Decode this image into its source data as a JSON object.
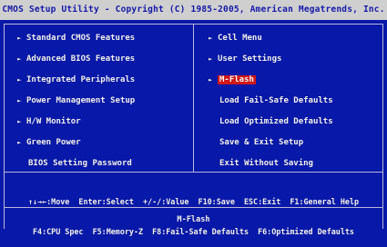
{
  "title": "CMOS Setup Utility - Copyright (C) 1985-2005, American Megatrends, Inc.",
  "left_menu": [
    {
      "label": "Standard CMOS Features",
      "arrow": true
    },
    {
      "label": "Advanced BIOS Features",
      "arrow": true
    },
    {
      "label": "Integrated Peripherals",
      "arrow": true
    },
    {
      "label": "Power Management Setup",
      "arrow": true
    },
    {
      "label": "H/W Monitor",
      "arrow": true
    },
    {
      "label": "Green Power",
      "arrow": true
    },
    {
      "label": "BIOS Setting Password",
      "arrow": false
    }
  ],
  "right_menu": [
    {
      "label": "Cell Menu",
      "arrow": true
    },
    {
      "label": "User Settings",
      "arrow": true
    },
    {
      "label": "M-Flash",
      "arrow": true,
      "selected": true
    },
    {
      "label": "Load Fail-Safe Defaults",
      "arrow": false
    },
    {
      "label": "Load Optimized Defaults",
      "arrow": false
    },
    {
      "label": "Save & Exit Setup",
      "arrow": false
    },
    {
      "label": "Exit Without Saving",
      "arrow": false
    }
  ],
  "arrow_glyph": "►",
  "help": {
    "line1": "↑↓→←:Move  Enter:Select  +/-/:Value  F10:Save  ESC:Exit  F1:General Help",
    "line2": "F4:CPU Spec  F5:Memory-Z  F8:Fail-Safe Defaults  F6:Optimized Defaults"
  },
  "status": "M-Flash",
  "colors": {
    "background": "#0818a8",
    "title_bar": "#cfcfcf",
    "selection": "#d01818",
    "text": "#f0f0e8"
  }
}
